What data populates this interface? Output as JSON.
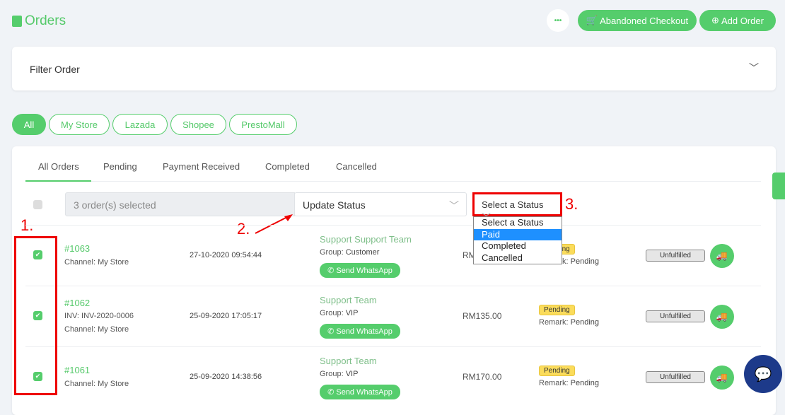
{
  "header": {
    "title": "Orders",
    "more_label": "•••",
    "abandoned_label": "Abandoned Checkout",
    "add_label": "Add Order"
  },
  "filter": {
    "title": "Filter Order"
  },
  "channels": [
    "All",
    "My Store",
    "Lazada",
    "Shopee",
    "PrestoMall"
  ],
  "tabs": [
    "All Orders",
    "Pending",
    "Payment Received",
    "Completed",
    "Cancelled"
  ],
  "bulk": {
    "selected": "3 order(s) selected",
    "update_status": "Update Status",
    "select_status": "Select a Status",
    "options": [
      "Select a Status",
      "Paid",
      "Completed",
      "Cancelled"
    ],
    "highlighted": "Paid"
  },
  "annotations": [
    "1.",
    "2.",
    "3."
  ],
  "orders": [
    {
      "id": "#1063",
      "inv": "",
      "channel": "Channel: My Store",
      "date": "27-10-2020 09:54:44",
      "customer": "Support Support Team",
      "group_label": "Group:",
      "group": "Customer",
      "whatsapp": "Send WhatsApp",
      "amount": "RM",
      "status": "Pending",
      "remark_label": "Remark:",
      "remark": "Pending",
      "fulfil": "Unfulfilled"
    },
    {
      "id": "#1062",
      "inv": "INV: INV-2020-0006",
      "channel": "Channel: My Store",
      "date": "25-09-2020 17:05:17",
      "customer": "Support Team",
      "group_label": "Group:",
      "group": "VIP",
      "whatsapp": "Send WhatsApp",
      "amount": "RM135.00",
      "status": "Pending",
      "remark_label": "Remark:",
      "remark": "Pending",
      "fulfil": "Unfulfilled"
    },
    {
      "id": "#1061",
      "inv": "",
      "channel": "Channel: My Store",
      "date": "25-09-2020 14:38:56",
      "customer": "Support Team",
      "group_label": "Group:",
      "group": "VIP",
      "whatsapp": "Send WhatsApp",
      "amount": "RM170.00",
      "status": "Pending",
      "remark_label": "Remark:",
      "remark": "Pending",
      "fulfil": "Unfulfilled"
    }
  ],
  "colors": {
    "accent": "#55cd6c",
    "annotation": "#ee0000",
    "highlight": "#1e90ff"
  }
}
